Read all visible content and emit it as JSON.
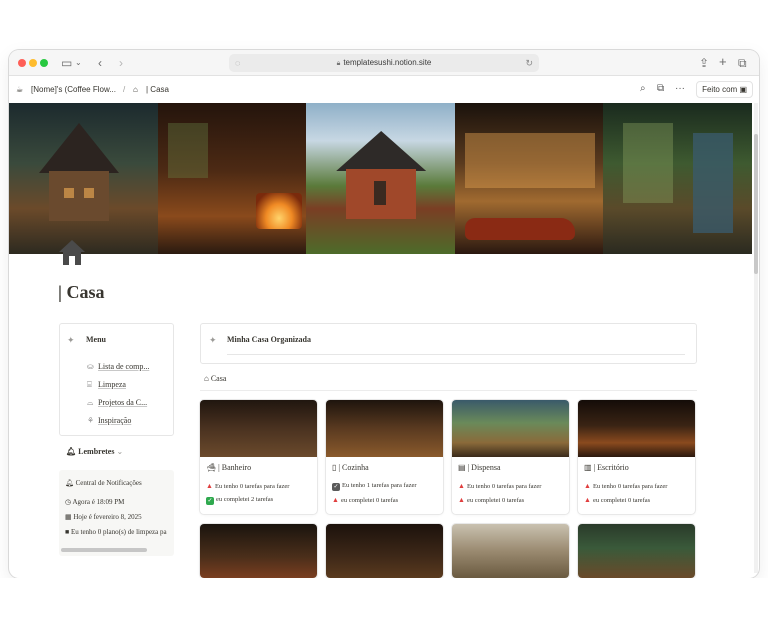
{
  "browser": {
    "url": "templatesushi.notion.site"
  },
  "breadcrumb": {
    "workspace": "[Nome]'s (Coffee Flow...",
    "separator": "/",
    "page": "| Casa"
  },
  "topbar": {
    "feito_com": "Feito com"
  },
  "page": {
    "title": "| Casa"
  },
  "menu": {
    "title": "Menu",
    "items": [
      {
        "icon": "basket-icon",
        "label": "Lista de comp..."
      },
      {
        "icon": "broom-icon",
        "label": "Limpeza"
      },
      {
        "icon": "sofa-icon",
        "label": "Projetos da C..."
      },
      {
        "icon": "plant-icon",
        "label": "Inspiração"
      }
    ]
  },
  "reminders": {
    "title": "Lembretes",
    "box_title": "Central de Notificações",
    "lines": [
      "Agora é 18:09 PM",
      "Hoje é fevereiro 8, 2025",
      "Eu tenho 0 plano(s) de limpeza pa"
    ]
  },
  "organized": {
    "title": "Minha Casa Organizada"
  },
  "database": {
    "label": "Casa"
  },
  "rooms": [
    {
      "title": "| Banheiro",
      "todo": "Eu tenho 0 tarefas para fazer",
      "todo_status": "red",
      "done": "eu completei 2 tarefas",
      "done_status": "green"
    },
    {
      "title": "| Cozinha",
      "todo": "Eu tenho 1 tarefas para fazer",
      "todo_status": "gray",
      "done": "eu completei 0 tarefas",
      "done_status": "red"
    },
    {
      "title": "| Dispensa",
      "todo": "Eu tenho 0 tarefas para fazer",
      "todo_status": "red",
      "done": "eu completei 0 tarefas",
      "done_status": "red"
    },
    {
      "title": "| Escritório",
      "todo": "Eu tenho 0 tarefas para fazer",
      "todo_status": "red",
      "done": "eu completei 0 tarefas",
      "done_status": "red"
    }
  ],
  "colors": {
    "accent_red": "#e03e3e",
    "accent_green": "#2fa94e",
    "text": "#37352f"
  }
}
